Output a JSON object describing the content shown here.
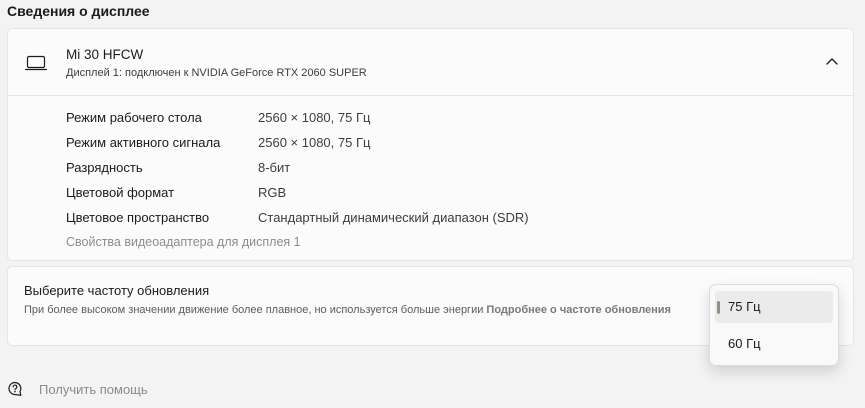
{
  "section_title": "Сведения о дисплее",
  "display": {
    "name": "Mi 30 HFCW",
    "subtitle": "Дисплей 1: подключен к NVIDIA GeForce RTX 2060 SUPER",
    "icon": "monitor-icon",
    "expand_icon": "chevron-up-icon"
  },
  "properties": [
    {
      "label": "Режим рабочего стола",
      "value": "2560 × 1080, 75 Гц"
    },
    {
      "label": "Режим активного сигнала",
      "value": "2560 × 1080, 75 Гц"
    },
    {
      "label": "Разрядность",
      "value": "8-бит"
    },
    {
      "label": "Цветовой формат",
      "value": "RGB"
    },
    {
      "label": "Цветовое пространство",
      "value": "Стандартный динамический диапазон (SDR)"
    }
  ],
  "adapter_link": "Свойства видеоадаптера для дисплея 1",
  "refresh": {
    "title": "Выберите частоту обновления",
    "description": "При более высоком значении движение более плавное, но используется больше энергии",
    "more_link": "Подробнее о частоте обновления"
  },
  "dropdown": {
    "options": [
      "75 Гц",
      "60 Гц"
    ],
    "selected": "75 Гц"
  },
  "help": {
    "label": "Получить помощь",
    "icon": "help-chat-icon"
  }
}
